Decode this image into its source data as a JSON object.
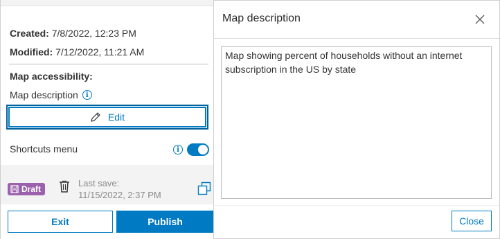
{
  "left_panel": {
    "created_label": "Created:",
    "created_value": "7/8/2022, 12:23 PM",
    "modified_label": "Modified:",
    "modified_value": "7/12/2022, 11:21 AM",
    "section_title": "Map accessibility:",
    "map_description_label": "Map description",
    "edit_label": "Edit",
    "shortcuts_label": "Shortcuts menu",
    "shortcuts_enabled": true,
    "draft_badge": "Draft",
    "last_save_label": "Last save:",
    "last_save_value": "11/15/2022, 2:37 PM",
    "exit_label": "Exit",
    "publish_label": "Publish"
  },
  "dialog": {
    "title": "Map description",
    "description_text": "Map showing percent of households without an internet subscription in the US by state",
    "close_label": "Close"
  },
  "colors": {
    "accent": "#007ac2",
    "draft_badge": "#9c61ad"
  },
  "icons": [
    "info-icon",
    "pencil-icon",
    "save-icon",
    "trash-icon",
    "duplicate-icon",
    "close-icon"
  ]
}
